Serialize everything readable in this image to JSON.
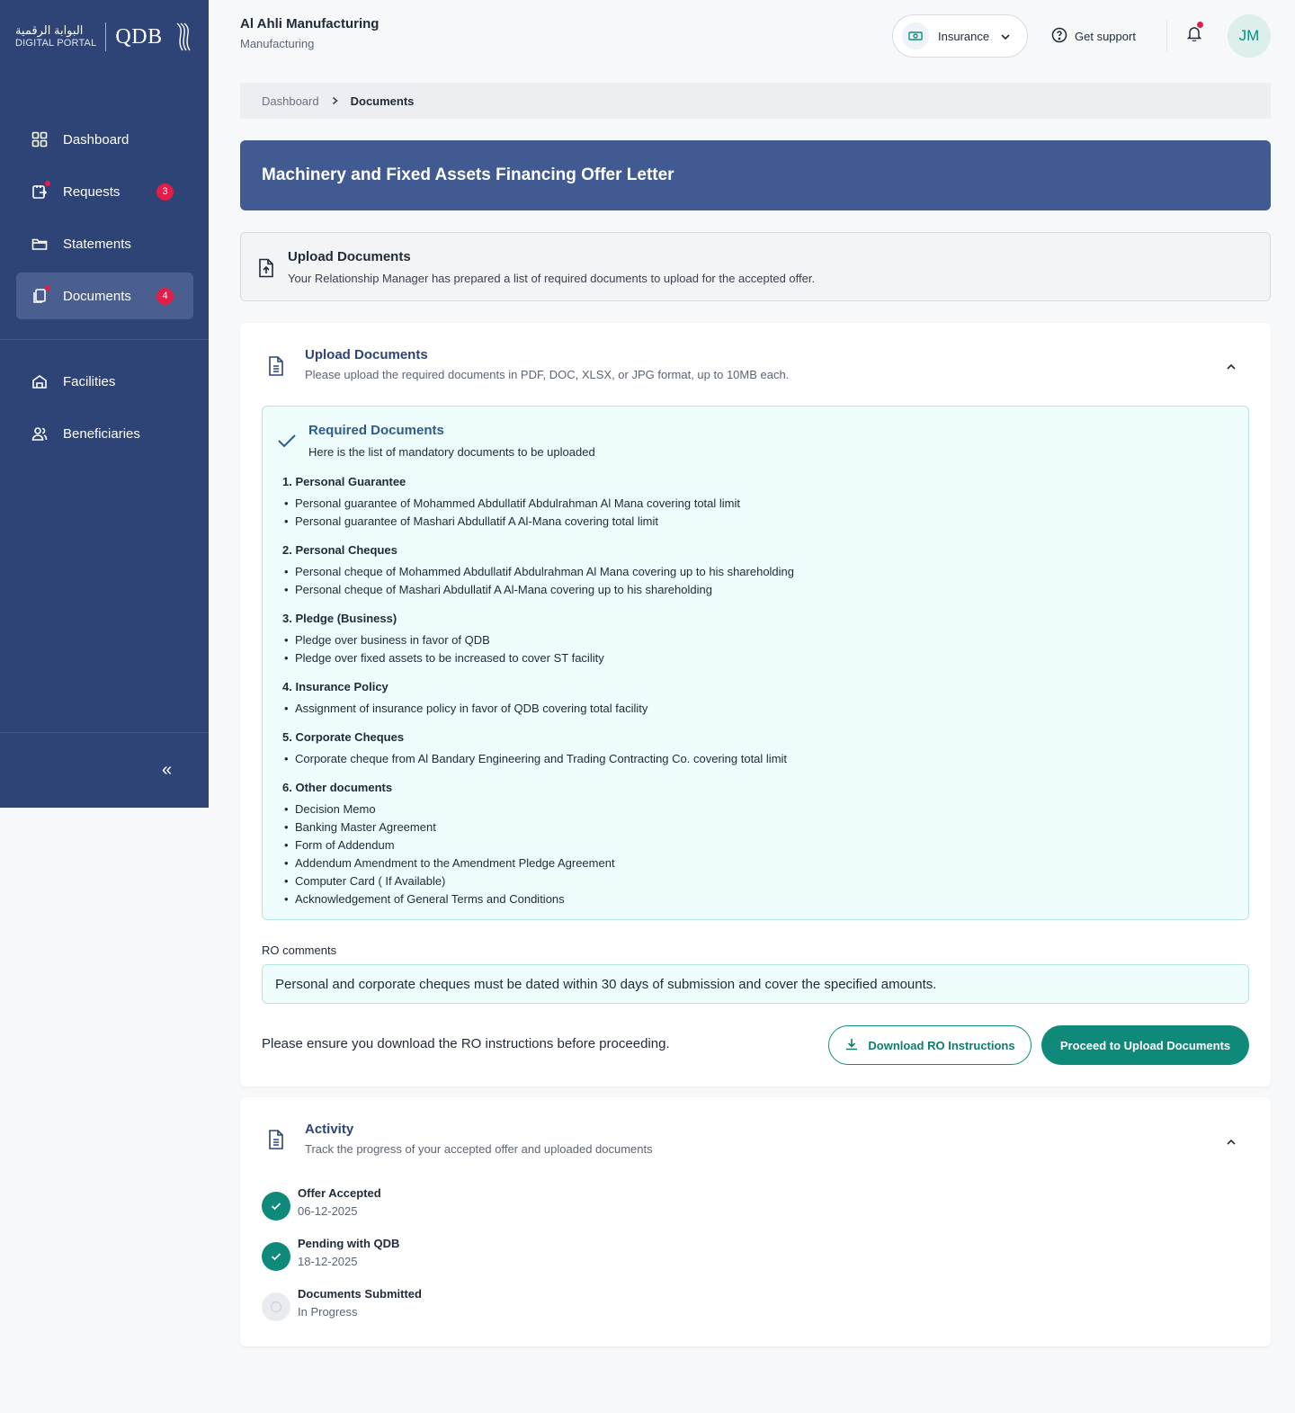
{
  "brand": {
    "arabic": "البوابة الرقمية",
    "english": "DIGITAL PORTAL",
    "qdb": "QDB"
  },
  "sidebar": {
    "items": [
      {
        "label": "Dashboard",
        "icon": "grid-icon",
        "badge": ""
      },
      {
        "label": "Requests",
        "icon": "requests-icon",
        "badge": "3"
      },
      {
        "label": "Statements",
        "icon": "folder-icon",
        "badge": ""
      },
      {
        "label": "Documents",
        "icon": "documents-icon",
        "badge": "4",
        "active": true
      },
      {
        "label": "Facilities",
        "icon": "facilities-icon",
        "badge": ""
      },
      {
        "label": "Beneficiaries",
        "icon": "beneficiaries-icon",
        "badge": ""
      }
    ],
    "collapse_icon": "«"
  },
  "header": {
    "company_name": "Al Ahli Manufacturing",
    "sector": "Manufacturing",
    "product_select": "Insurance",
    "support_label": "Get support",
    "avatar_initials": "JM"
  },
  "breadcrumb": {
    "root": "Dashboard",
    "current": "Documents"
  },
  "page_title": "Machinery and Fixed Assets Financing Offer Letter",
  "info": {
    "title": "Upload Documents",
    "text": "Your Relationship Manager has prepared a list of required documents to upload for the accepted offer."
  },
  "upload_card": {
    "title": "Upload Documents",
    "subtitle": "Please upload the required documents in PDF, DOC, XLSX, or JPG format, up to 10MB each.",
    "required": {
      "title": "Required Documents",
      "subtitle": "Here is the list of mandatory documents to be uploaded",
      "groups": [
        {
          "title": "1. Personal Guarantee",
          "items": [
            "Personal guarantee of Mohammed Abdullatif Abdulrahman Al Mana covering total limit",
            "Personal guarantee of Mashari Abdullatif A Al-Mana covering total limit"
          ]
        },
        {
          "title": "2. Personal Cheques",
          "items": [
            "Personal cheque of Mohammed Abdullatif Abdulrahman Al Mana covering up to his shareholding",
            "Personal cheque of Mashari Abdullatif A Al-Mana covering up to his shareholding"
          ]
        },
        {
          "title": "3. Pledge (Business)",
          "items": [
            "Pledge over business in favor of QDB",
            "Pledge over fixed assets to be increased to cover ST facility"
          ]
        },
        {
          "title": "4. Insurance Policy",
          "items": [
            "Assignment of insurance policy in favor of QDB covering total facility"
          ]
        },
        {
          "title": "5. Corporate Cheques",
          "items": [
            "Corporate cheque from Al Bandary Engineering and Trading Contracting Co. covering total limit"
          ]
        },
        {
          "title": "6. Other documents",
          "items": [
            "Decision Memo",
            "Banking Master Agreement",
            "Form of Addendum",
            "Addendum Amendment to the Amendment Pledge Agreement",
            "Computer Card ( If Available)",
            "Acknowledgement of General Terms and Conditions"
          ]
        }
      ]
    },
    "ro_label": "RO comments",
    "ro_comment": "Personal and corporate cheques must be dated within 30 days of submission and cover the specified amounts.",
    "ensure_text": "Please ensure you download the RO instructions before proceeding.",
    "download_label": "Download RO Instructions",
    "proceed_label": "Proceed to Upload Documents"
  },
  "activity": {
    "title": "Activity",
    "subtitle": "Track the progress of your accepted offer and uploaded documents",
    "steps": [
      {
        "label": "Offer Accepted",
        "sub": "06-12-2025",
        "status": "done"
      },
      {
        "label": "Pending with QDB",
        "sub": "18-12-2025",
        "status": "done"
      },
      {
        "label": "Documents Submitted",
        "sub": "In Progress",
        "status": "pending"
      }
    ]
  },
  "colors": {
    "sidebar": "#2e4476",
    "banner": "#415b92",
    "accent": "#0f8a7a",
    "badge": "#e11d48"
  }
}
